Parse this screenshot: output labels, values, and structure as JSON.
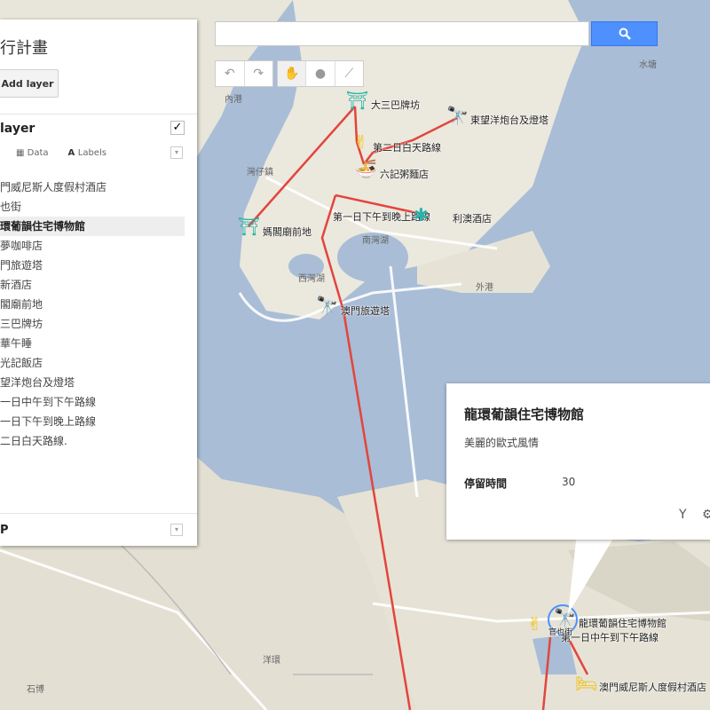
{
  "search": {
    "value": "",
    "placeholder": "",
    "icon": "search-icon"
  },
  "toolbar": {
    "undo": "↶",
    "redo": "↷",
    "pan": "✋",
    "marker": "●",
    "line": "⟋"
  },
  "panel": {
    "title": "行計畫",
    "add_layer": "Add layer",
    "layer_name": "layer",
    "data_label": "Data",
    "labels_label": "Labels",
    "items": [
      "門威尼斯人度假村酒店",
      "也街",
      "環葡韻住宅博物館",
      "夢咖啡店",
      "門旅遊塔",
      "新酒店",
      "閣廟前地",
      "三巴牌坊",
      "華午睡",
      "光記飯店",
      "望洋炮台及燈塔",
      "一日中午到下午路線",
      "一日下午到晚上路線",
      "二日白天路線."
    ],
    "selected_index": 2,
    "layer2_name": "P"
  },
  "popup": {
    "title": "龍環葡韻住宅博物館",
    "description": "美麗的歐式風情",
    "field_name": "停留時間",
    "field_value": "30"
  },
  "map": {
    "markers": [
      {
        "label": "大三巴牌坊",
        "icon": "⛩"
      },
      {
        "label": "東望洋炮台及燈塔",
        "icon": "🔭"
      },
      {
        "label": "第二日白天路線",
        "icon": "✌"
      },
      {
        "label": "六記粥麵店",
        "icon": "🍜"
      },
      {
        "label": "第一日下午到晚上路線",
        "icon": ""
      },
      {
        "label": "利澳酒店",
        "icon": "✱"
      },
      {
        "label": "媽閣廟前地",
        "icon": "⛩"
      },
      {
        "label": "澳門旅遊塔",
        "icon": "🔭"
      },
      {
        "label": "龍環葡韻住宅博物館",
        "icon": "🔭"
      },
      {
        "label": "第一日中午到下午路線",
        "icon": ""
      },
      {
        "label": "官也街",
        "icon": "✌"
      },
      {
        "label": "澳門威尼斯人度假村酒店",
        "icon": "🛏"
      }
    ],
    "places": [
      "內港",
      "水塘",
      "南灣湖",
      "西灣湖",
      "外港",
      "灣仔鎮",
      "洋環",
      "石博"
    ],
    "route_color": "#e2453c",
    "water_color": "#a9bdd6",
    "land_color": "#e8e5da"
  }
}
